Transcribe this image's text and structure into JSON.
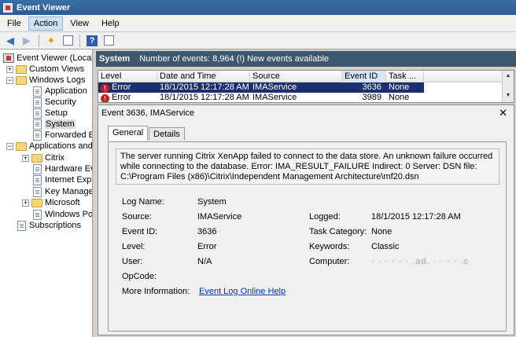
{
  "window": {
    "title": "Event Viewer"
  },
  "menu": {
    "items": [
      "File",
      "Action",
      "View",
      "Help"
    ]
  },
  "tree": {
    "root": "Event Viewer (Local)",
    "custom_views": "Custom Views",
    "windows_logs": "Windows Logs",
    "application": "Application",
    "security": "Security",
    "setup": "Setup",
    "system": "System",
    "forwarded": "Forwarded Ev",
    "apps_services": "Applications and S",
    "citrix": "Citrix",
    "hardware": "Hardware Eve",
    "internet": "Internet Expl",
    "key": "Key Managen",
    "microsoft": "Microsoft",
    "powershell": "Windows Pow",
    "subscriptions": "Subscriptions"
  },
  "header": {
    "title": "System",
    "info": "Number of events: 8,964 (!) New events available"
  },
  "grid": {
    "columns": [
      "Level",
      "Date and Time",
      "Source",
      "Event ID",
      "Task ..."
    ],
    "rows": [
      {
        "level": "Error",
        "datetime": "18/1/2015 12:17:28 AM",
        "source": "IMAService",
        "event_id": "3636",
        "task": "None"
      },
      {
        "level": "Error",
        "datetime": "18/1/2015 12:17:28 AM",
        "source": "IMAService",
        "event_id": "3989",
        "task": "None"
      }
    ]
  },
  "detail": {
    "title": "Event 3636, IMAService",
    "tabs": [
      "General",
      "Details"
    ],
    "message": "The server running Citrix XenApp failed to connect to the data store. An unknown failure occurred while connecting to the database. Error: IMA_RESULT_FAILURE  Indirect: 0  Server:   DSN file: C:\\Program Files (x86)\\Citrix\\Independent Management Architecture\\mf20.dsn",
    "labels": {
      "log_name": "Log Name:",
      "source": "Source:",
      "event_id": "Event ID:",
      "level": "Level:",
      "user": "User:",
      "opcode": "OpCode:",
      "more_info": "More Information:",
      "logged": "Logged:",
      "task_category": "Task Category:",
      "keywords": "Keywords:",
      "computer": "Computer:"
    },
    "values": {
      "log_name": "System",
      "source": "IMAService",
      "event_id": "3636",
      "level": "Error",
      "user": "N/A",
      "opcode": "",
      "more_info_link": "Event Log Online Help",
      "logged": "18/1/2015 12:17:28 AM",
      "task_category": "None",
      "keywords": "Classic",
      "computer": "· ·  ·  ·  · ·  .ad.  ·  ·  ·  · .c"
    }
  }
}
